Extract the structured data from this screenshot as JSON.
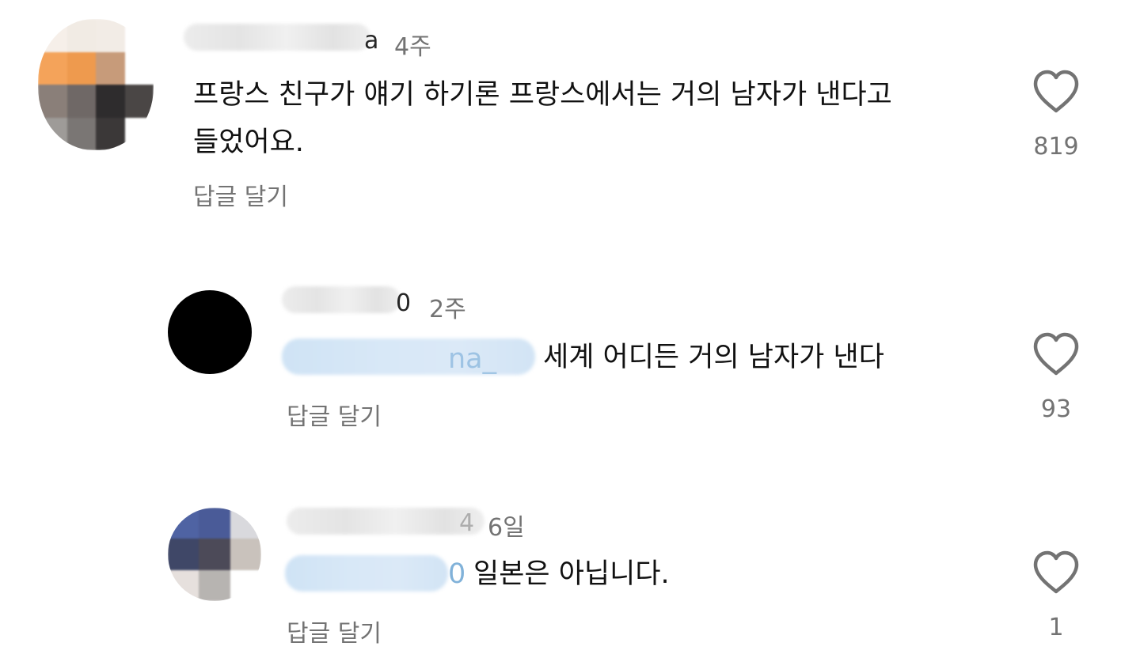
{
  "comments": [
    {
      "username_tail": "a",
      "time": "4주",
      "text_line1": "프랑스 친구가 얘기 하기론 프랑스에서는 거의 남자가 낸다고",
      "text_line2": "들었어요.",
      "reply_label": "답글 달기",
      "likes": "819",
      "avatar": "pixelated-avatar"
    },
    {
      "username_tail": "0",
      "time": "2주",
      "mention_tail": "na_",
      "text": "세계 어디든 거의 남자가 낸다",
      "reply_label": "답글 달기",
      "likes": "93",
      "avatar": "black-circle-avatar"
    },
    {
      "username_tail": "4",
      "time": "6일",
      "mention_tail": "0",
      "text": "일본은 아닙니다.",
      "reply_label": "답글 달기",
      "likes": "1",
      "avatar": "pixelated-avatar"
    }
  ],
  "colors": {
    "meta": "#737373",
    "mention": "#2f7fc1",
    "text": "#111111"
  },
  "icons": {
    "like": "heart-outline-icon"
  }
}
